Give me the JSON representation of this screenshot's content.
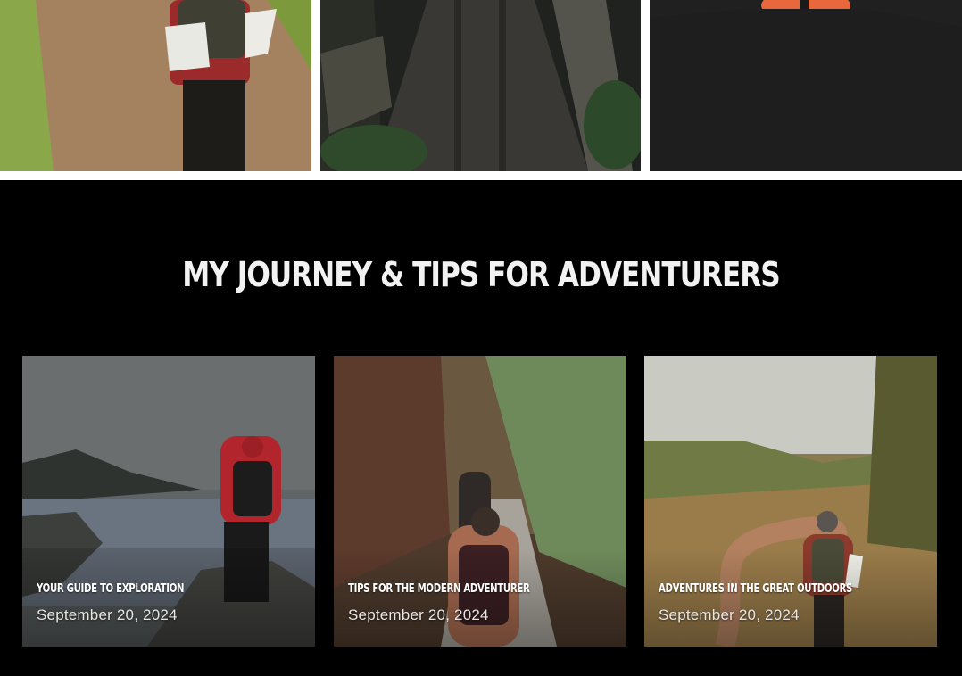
{
  "gallery": {
    "images": [
      {
        "icon": "hiker-trail-image"
      },
      {
        "icon": "forest-bridge-image"
      },
      {
        "icon": "sunset-silhouette-image"
      }
    ]
  },
  "blog": {
    "heading": "MY JOURNEY & TIPS FOR ADVENTURERS",
    "posts": [
      {
        "title": "YOUR GUIDE TO EXPLORATION",
        "date": "September 20, 2024"
      },
      {
        "title": "TIPS FOR THE MODERN ADVENTURER",
        "date": "September 20, 2024"
      },
      {
        "title": "ADVENTURES IN THE GREAT OUTDOORS",
        "date": "September 20, 2024"
      }
    ]
  },
  "colors": {
    "section_bg": "#000000",
    "heading": "#f2f2f2",
    "page_bg": "#ffffff"
  }
}
